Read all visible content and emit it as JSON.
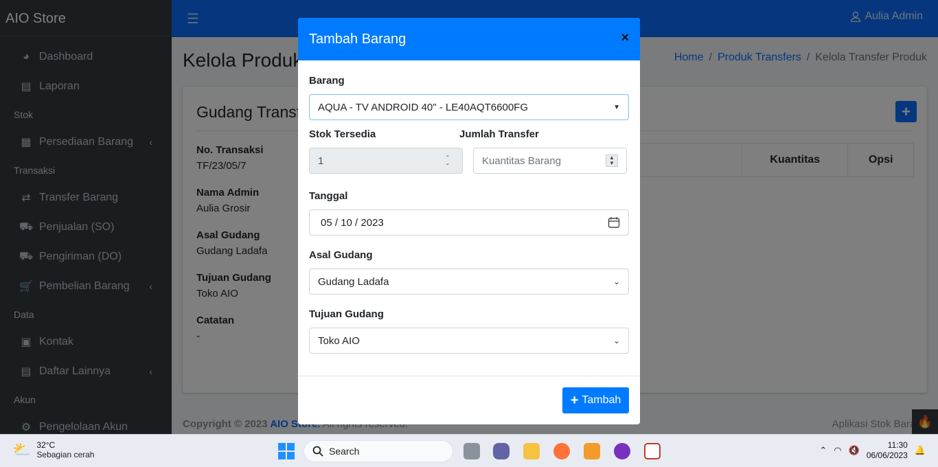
{
  "app": {
    "brand": "AIO Store",
    "user": "Aulia Admin"
  },
  "sidebar": {
    "items": [
      {
        "type": "item",
        "label": "Dashboard",
        "icon": "tachometer-icon"
      },
      {
        "type": "item",
        "label": "Laporan",
        "icon": "file-icon"
      },
      {
        "type": "header",
        "label": "Stok"
      },
      {
        "type": "item",
        "label": "Persediaan Barang",
        "icon": "grid-icon",
        "chevron": true
      },
      {
        "type": "header",
        "label": "Transaksi"
      },
      {
        "type": "item",
        "label": "Transfer Barang",
        "icon": "exchange-icon"
      },
      {
        "type": "item",
        "label": "Penjualan (SO)",
        "icon": "dolly-icon"
      },
      {
        "type": "item",
        "label": "Pengiriman (DO)",
        "icon": "truck-icon"
      },
      {
        "type": "item",
        "label": "Pembelian Barang",
        "icon": "cart-icon",
        "chevron": true
      },
      {
        "type": "header",
        "label": "Data"
      },
      {
        "type": "item",
        "label": "Kontak",
        "icon": "contact-icon"
      },
      {
        "type": "item",
        "label": "Daftar Lainnya",
        "icon": "file-icon",
        "chevron": true
      },
      {
        "type": "header",
        "label": "Akun"
      },
      {
        "type": "item",
        "label": "Pengelolaan Akun",
        "icon": "users-cog-icon"
      }
    ]
  },
  "page": {
    "title": "Kelola Produk Transfer",
    "breadcrumb": {
      "home": "Home",
      "mid": "Produk Transfers",
      "current": "Kelola Transfer Produk"
    },
    "card_title": "Gudang Transfer",
    "info": [
      {
        "label": "No. Transaksi",
        "value": "TF/23/05/7"
      },
      {
        "label": "Nama Admin",
        "value": "Aulia Grosir"
      },
      {
        "label": "Asal Gudang",
        "value": "Gudang Ladafa"
      },
      {
        "label": "Tujuan Gudang",
        "value": "Toko AIO"
      },
      {
        "label": "Catatan",
        "value": "-"
      }
    ],
    "table_headers": {
      "qty": "Kuantitas",
      "opsi": "Opsi"
    }
  },
  "footer": {
    "copyright": "Copyright © 2023 ",
    "brand": "AIO Store.",
    "rights": " All rights reserved.",
    "right": "Aplikasi Stok Barang"
  },
  "modal": {
    "title": "Tambah Barang",
    "close": "×",
    "barang_label": "Barang",
    "barang_value": "AQUA - TV ANDROID 40\" - LE40AQT6600FG",
    "stok_label": "Stok Tersedia",
    "stok_value": "1",
    "jumlah_label": "Jumlah Transfer",
    "jumlah_placeholder": "Kuantitas Barang",
    "tanggal_label": "Tanggal",
    "tanggal_value": "05 / 10 / 2023",
    "asal_label": "Asal Gudang",
    "asal_value": "Gudang Ladafa",
    "tujuan_label": "Tujuan Gudang",
    "tujuan_value": "Toko AIO",
    "submit": "Tambah"
  },
  "taskbar": {
    "temp": "32°C",
    "weather": "Sebagian cerah",
    "search": "Search",
    "time": "11:30",
    "date": "06/06/2023"
  },
  "colors": {
    "primary": "#007bff",
    "sidebar": "#343a40",
    "topbar": "#0d6efd"
  }
}
